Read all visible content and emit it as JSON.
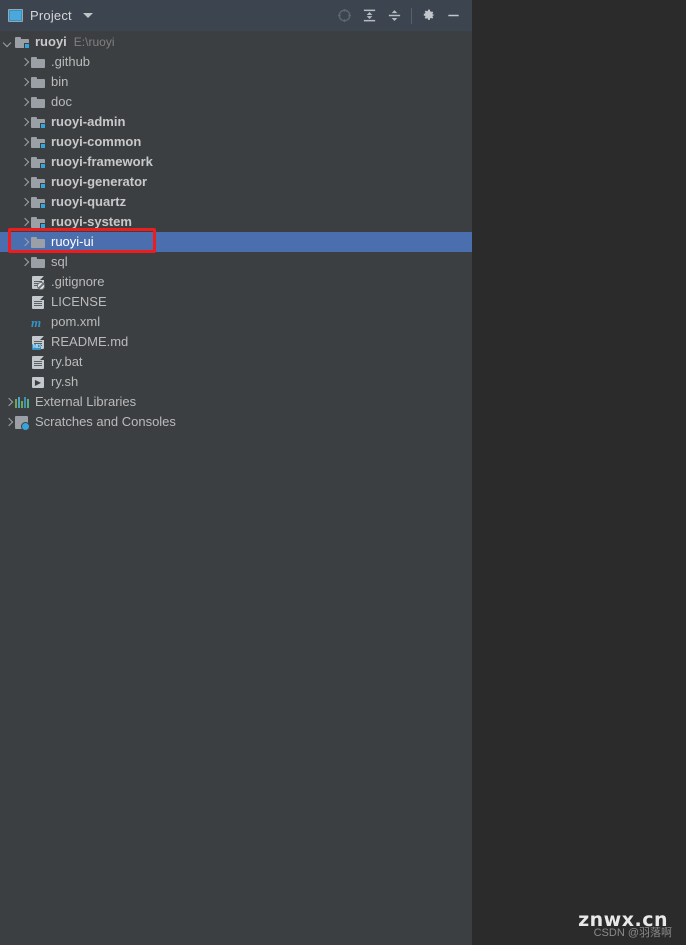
{
  "window": {
    "background_color": "#2b2b2b",
    "panel_background_color": "#3c3f41",
    "header_background_color": "#3c4450",
    "selection_color": "#4b6eaf",
    "annotation_color": "#ee1c1c"
  },
  "header": {
    "title": "Project",
    "icon": "project-window-icon",
    "dropdown_icon": "chevron-down-icon",
    "actions": [
      {
        "name": "select-opened-file-icon",
        "tooltip": "Select Opened File"
      },
      {
        "name": "expand-all-icon",
        "tooltip": "Expand All"
      },
      {
        "name": "collapse-all-icon",
        "tooltip": "Collapse All"
      },
      {
        "name": "settings-gear-icon",
        "tooltip": "Settings"
      },
      {
        "name": "hide-icon",
        "tooltip": "Hide"
      }
    ]
  },
  "tree": {
    "nodes": [
      {
        "label": "ruoyi",
        "path": "E:\\ruoyi",
        "icon": "module-folder-icon",
        "indent": 0,
        "arrow": "expanded",
        "bold": true,
        "selected": false
      },
      {
        "label": ".github",
        "icon": "folder-icon",
        "indent": 1,
        "arrow": "collapsed",
        "bold": false,
        "selected": false
      },
      {
        "label": "bin",
        "icon": "folder-icon",
        "indent": 1,
        "arrow": "collapsed",
        "bold": false,
        "selected": false
      },
      {
        "label": "doc",
        "icon": "folder-icon",
        "indent": 1,
        "arrow": "collapsed",
        "bold": false,
        "selected": false
      },
      {
        "label": "ruoyi-admin",
        "icon": "module-folder-icon",
        "indent": 1,
        "arrow": "collapsed",
        "bold": true,
        "selected": false
      },
      {
        "label": "ruoyi-common",
        "icon": "module-folder-icon",
        "indent": 1,
        "arrow": "collapsed",
        "bold": true,
        "selected": false
      },
      {
        "label": "ruoyi-framework",
        "icon": "module-folder-icon",
        "indent": 1,
        "arrow": "collapsed",
        "bold": true,
        "selected": false
      },
      {
        "label": "ruoyi-generator",
        "icon": "module-folder-icon",
        "indent": 1,
        "arrow": "collapsed",
        "bold": true,
        "selected": false
      },
      {
        "label": "ruoyi-quartz",
        "icon": "module-folder-icon",
        "indent": 1,
        "arrow": "collapsed",
        "bold": true,
        "selected": false
      },
      {
        "label": "ruoyi-system",
        "icon": "module-folder-icon",
        "indent": 1,
        "arrow": "collapsed",
        "bold": true,
        "selected": false
      },
      {
        "label": "ruoyi-ui",
        "icon": "folder-icon",
        "indent": 1,
        "arrow": "collapsed",
        "bold": false,
        "selected": true
      },
      {
        "label": "sql",
        "icon": "folder-icon",
        "indent": 1,
        "arrow": "collapsed",
        "bold": false,
        "selected": false
      },
      {
        "label": ".gitignore",
        "icon": "gitignore-file-icon",
        "indent": 1,
        "arrow": "none",
        "bold": false,
        "selected": false
      },
      {
        "label": "LICENSE",
        "icon": "text-file-icon",
        "indent": 1,
        "arrow": "none",
        "bold": false,
        "selected": false
      },
      {
        "label": "pom.xml",
        "icon": "maven-pom-icon",
        "indent": 1,
        "arrow": "none",
        "bold": false,
        "selected": false
      },
      {
        "label": "README.md",
        "icon": "markdown-file-icon",
        "indent": 1,
        "arrow": "none",
        "bold": false,
        "selected": false
      },
      {
        "label": "ry.bat",
        "icon": "text-file-icon",
        "indent": 1,
        "arrow": "none",
        "bold": false,
        "selected": false
      },
      {
        "label": "ry.sh",
        "icon": "shell-script-icon",
        "indent": 1,
        "arrow": "none",
        "bold": false,
        "selected": false
      },
      {
        "label": "External Libraries",
        "icon": "external-libraries-icon",
        "indent": 0,
        "arrow": "collapsed",
        "bold": false,
        "selected": false
      },
      {
        "label": "Scratches and Consoles",
        "icon": "scratches-icon",
        "indent": 0,
        "arrow": "collapsed",
        "bold": false,
        "selected": false
      }
    ]
  },
  "annotation": {
    "target_label": "ruoyi-ui",
    "shape": "rectangle",
    "color": "#ee1c1c"
  },
  "watermark": {
    "main": "znwx.cn",
    "sub": "CSDN @羽落啊"
  }
}
